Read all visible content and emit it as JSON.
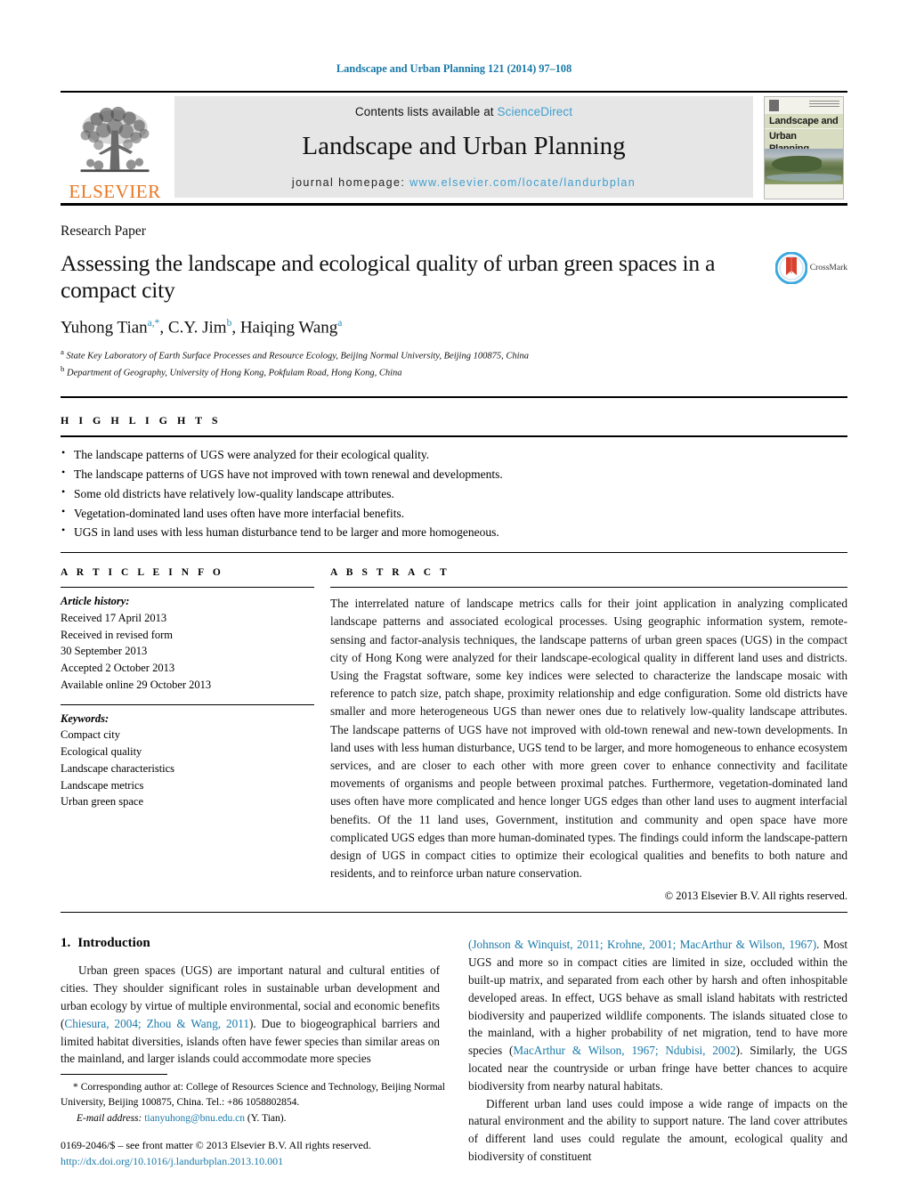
{
  "running_head": "Landscape and Urban Planning 121 (2014) 97–108",
  "masthead": {
    "publisher_name": "ELSEVIER",
    "contents_prefix": "Contents lists available at ",
    "contents_link": "ScienceDirect",
    "journal_title": "Landscape and Urban Planning",
    "homepage_prefix": "journal homepage: ",
    "homepage_url": "www.elsevier.com/locate/landurbplan",
    "cover_title_line1": "Landscape and",
    "cover_title_line2": "Urban Planning"
  },
  "article": {
    "type": "Research Paper",
    "title": "Assessing the landscape and ecological quality of urban green spaces in a compact city",
    "crossmark_label": "CrossMark",
    "authors_html": "Yuhong Tian<sup>a,*</sup>, C.Y. Jim<sup>b</sup>, Haiqing Wang<sup>a</sup>",
    "affiliations": [
      "State Key Laboratory of Earth Surface Processes and Resource Ecology, Beijing Normal University, Beijing 100875, China",
      "Department of Geography, University of Hong Kong, Pokfulam Road, Hong Kong, China"
    ],
    "affiliation_marks": [
      "a",
      "b"
    ]
  },
  "highlights": {
    "heading": "H I G H L I G H T S",
    "items": [
      "The landscape patterns of UGS were analyzed for their ecological quality.",
      "The landscape patterns of UGS have not improved with town renewal and developments.",
      "Some old districts have relatively low-quality landscape attributes.",
      "Vegetation-dominated land uses often have more interfacial benefits.",
      "UGS in land uses with less human disturbance tend to be larger and more homogeneous."
    ]
  },
  "article_info": {
    "heading": "A R T I C L E    I N F O",
    "history_label": "Article history:",
    "history": [
      "Received 17 April 2013",
      "Received in revised form",
      "30 September 2013",
      "Accepted 2 October 2013",
      "Available online 29 October 2013"
    ],
    "keywords_label": "Keywords:",
    "keywords": [
      "Compact city",
      "Ecological quality",
      "Landscape characteristics",
      "Landscape metrics",
      "Urban green space"
    ]
  },
  "abstract": {
    "heading": "A B S T R A C T",
    "text": "The interrelated nature of landscape metrics calls for their joint application in analyzing complicated landscape patterns and associated ecological processes. Using geographic information system, remote-sensing and factor-analysis techniques, the landscape patterns of urban green spaces (UGS) in the compact city of Hong Kong were analyzed for their landscape-ecological quality in different land uses and districts. Using the Fragstat software, some key indices were selected to characterize the landscape mosaic with reference to patch size, patch shape, proximity relationship and edge configuration. Some old districts have smaller and more heterogeneous UGS than newer ones due to relatively low-quality landscape attributes. The landscape patterns of UGS have not improved with old-town renewal and new-town developments. In land uses with less human disturbance, UGS tend to be larger, and more homogeneous to enhance ecosystem services, and are closer to each other with more green cover to enhance connectivity and facilitate movements of organisms and people between proximal patches. Furthermore, vegetation-dominated land uses often have more complicated and hence longer UGS edges than other land uses to augment interfacial benefits. Of the 11 land uses, Government, institution and community and open space have more complicated UGS edges than more human-dominated types. The findings could inform the landscape-pattern design of UGS in compact cities to optimize their ecological qualities and benefits to both nature and residents, and to reinforce urban nature conservation.",
    "copyright": "© 2013 Elsevier B.V. All rights reserved."
  },
  "introduction": {
    "number": "1.",
    "heading": "Introduction",
    "para1_a": "Urban green spaces (UGS) are important natural and cultural entities of cities. They shoulder significant roles in sustainable urban development and urban ecology by virtue of multiple environmental, social and economic benefits (",
    "para1_cite1": "Chiesura, 2004; Zhou & Wang, 2011",
    "para1_b": "). Due to biogeographical barriers and limited habitat diversities, islands often have fewer species than similar areas on the mainland, and larger islands could accommodate more species",
    "para2_cite1": "(Johnson & Winquist, 2011; Krohne, 2001; MacArthur & Wilson, 1967)",
    "para2_a": ". Most UGS and more so in compact cities are limited in size, occluded within the built-up matrix, and separated from each other by harsh and often inhospitable developed areas. In effect, UGS behave as small island habitats with restricted biodiversity and pauperized wildlife components. The islands situated close to the mainland, with a higher probability of net migration, tend to have more species (",
    "para2_cite2": "MacArthur & Wilson, 1967; Ndubisi, 2002",
    "para2_b": "). Similarly, the UGS located near the countryside or urban fringe have better chances to acquire biodiversity from nearby natural habitats.",
    "para3": "Different urban land uses could impose a wide range of impacts on the natural environment and the ability to support nature. The land cover attributes of different land uses could regulate the amount, ecological quality and biodiversity of constituent"
  },
  "footnote": {
    "corresponding": "* Corresponding author at: College of Resources Science and Technology, Beijing Normal University, Beijing 100875, China. Tel.: +86 1058802854.",
    "email_label": "E-mail address:",
    "email": "tianyuhong@bnu.edu.cn",
    "email_suffix": "(Y. Tian).",
    "issn_line": "0169-2046/$ – see front matter © 2013 Elsevier B.V. All rights reserved.",
    "doi": "http://dx.doi.org/10.1016/j.landurbplan.2013.10.001"
  },
  "colors": {
    "link_blue": "#1a7aa8",
    "sciencedirect_blue": "#3f9fcf",
    "elsevier_orange": "#E87722",
    "crossmark_blue": "#3fa9dd",
    "crossmark_red": "#d8402f"
  }
}
